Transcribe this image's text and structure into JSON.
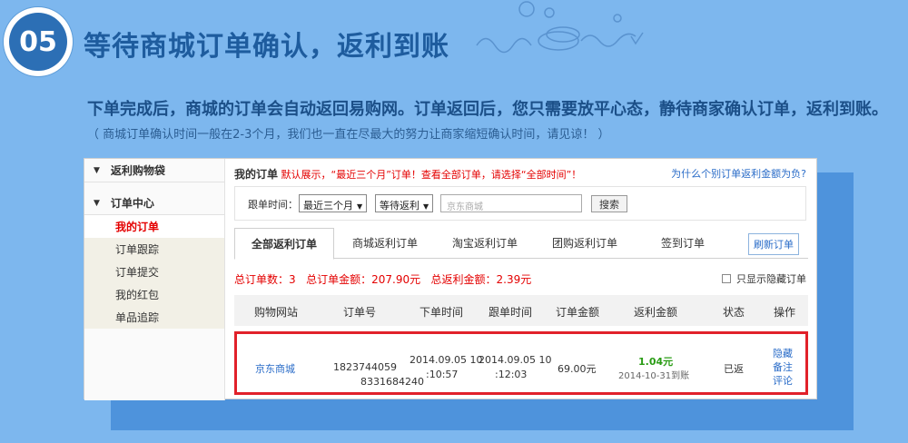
{
  "step": {
    "number": "05",
    "title": "等待商城订单确认，返利到账",
    "description": "下单完成后，商城的订单会自动返回易购网。订单返回后，您只需要放平心态，静待商家确认订单，返利到账。",
    "note": "（ 商城订单确认时间一般在2-3个月，我们也一直在尽最大的努力让商家缩短确认时间，请见谅！ ）"
  },
  "sidebar": {
    "groups": [
      {
        "label": "返利购物袋",
        "icon": "triangle-down-icon"
      },
      {
        "label": "订单中心",
        "icon": "triangle-down-icon"
      }
    ],
    "items": [
      {
        "label": "我的订单",
        "active": true
      },
      {
        "label": "订单跟踪",
        "active": false
      },
      {
        "label": "订单提交",
        "active": false
      },
      {
        "label": "我的红包",
        "active": false
      },
      {
        "label": "单品追踪",
        "active": false
      }
    ]
  },
  "orders": {
    "heading": "我的订单",
    "notice": "默认展示，“最近三个月”订单！查看全部订单，请选择“全部时间”！",
    "help_link": "为什么个别订单返利金额为负?",
    "filter_label": "跟单时间：",
    "time_select": "最近三个月",
    "status_select": "等待返利",
    "search_placeholder": "京东商城",
    "search_button": "搜索",
    "tabs": [
      "全部返利订单",
      "商城返利订单",
      "淘宝返利订单",
      "团购返利订单",
      "签到订单"
    ],
    "refresh_button": "刷新订单",
    "summary": {
      "total_orders": "总订单数：3",
      "total_amount": "总订单金额：207.90元",
      "total_rebate": "总返利金额：2.39元"
    },
    "hide_option": "只显示隐藏订单",
    "columns": [
      "购物网站",
      "订单号",
      "下单时间",
      "跟单时间",
      "订单金额",
      "返利金额",
      "状态",
      "操作"
    ],
    "row": {
      "site": "京东商城",
      "order_no_1": "1823744059",
      "order_no_2": "8331684240",
      "order_time_1": "2014.09.05 10",
      "order_time_2": ":10:57",
      "track_time_1": "2014.09.05 10",
      "track_time_2": ":12:03",
      "amount": "69.00元",
      "rebate": "1.04元",
      "rebate_date": "2014-10-31到账",
      "status": "已返",
      "ops": [
        "隐藏",
        "备注",
        "评论"
      ]
    }
  },
  "colors": {
    "background": "#7db7ee",
    "badge": "#2c6fb5",
    "title": "#1e5c9e",
    "alert_red": "#e40000",
    "link_blue": "#2a6cc8",
    "rebate_green": "#2a9c15",
    "highlight_border": "#e1212a"
  }
}
